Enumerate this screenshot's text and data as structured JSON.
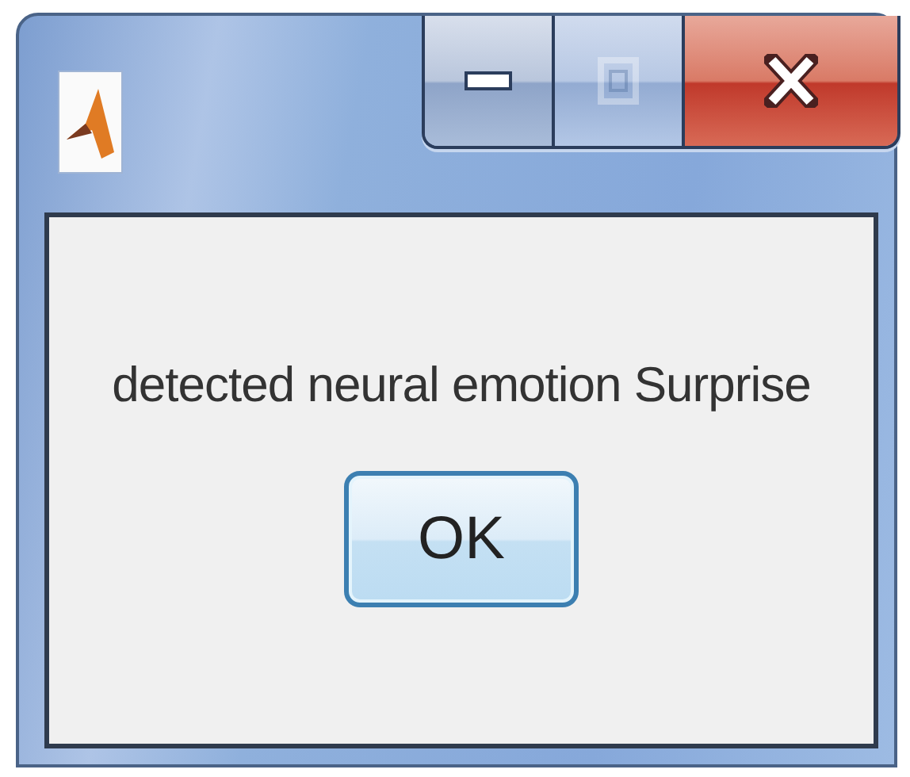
{
  "window": {
    "caption_buttons": [
      {
        "kind": "minimize",
        "disabled": false
      },
      {
        "kind": "maximize",
        "disabled": true
      },
      {
        "kind": "close",
        "disabled": false
      }
    ]
  },
  "message": "detected neural emotion Surprise",
  "buttons": [
    "OK"
  ]
}
